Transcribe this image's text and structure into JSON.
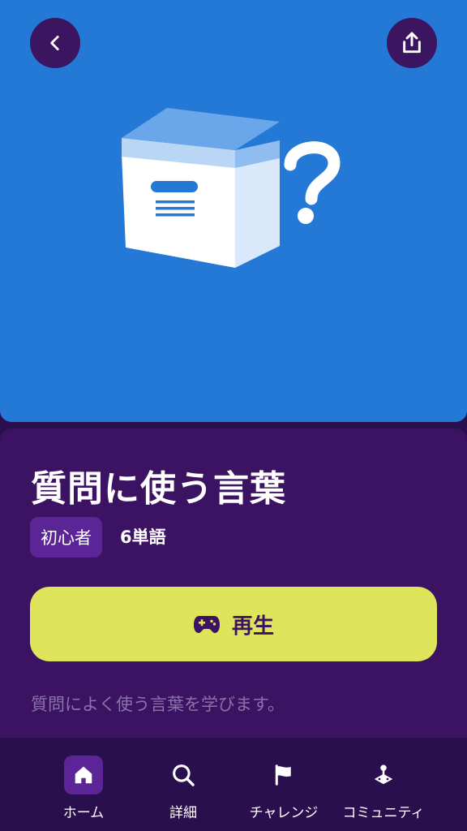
{
  "header": {
    "back_icon": "chevron-left-icon",
    "share_icon": "share-icon"
  },
  "hero": {
    "illustration": "box-question-illustration",
    "background_color": "#2479d6"
  },
  "lesson": {
    "title": "質問に使う言葉",
    "level_badge": "初心者",
    "word_count": "6単語",
    "play_label": "再生",
    "play_icon": "gamepad-icon",
    "description": "質問によく使う言葉を学びます。"
  },
  "nav": {
    "active_index": 0,
    "items": [
      {
        "label": "ホーム",
        "icon": "home-icon"
      },
      {
        "label": "詳細",
        "icon": "search-icon"
      },
      {
        "label": "チャレンジ",
        "icon": "flag-icon"
      },
      {
        "label": "コミュニティ",
        "icon": "joystick-icon"
      }
    ]
  },
  "colors": {
    "panel": "#3b1362",
    "accent": "#dfe55a",
    "badge": "#5b2597",
    "nav_background": "#2a0f4f"
  }
}
